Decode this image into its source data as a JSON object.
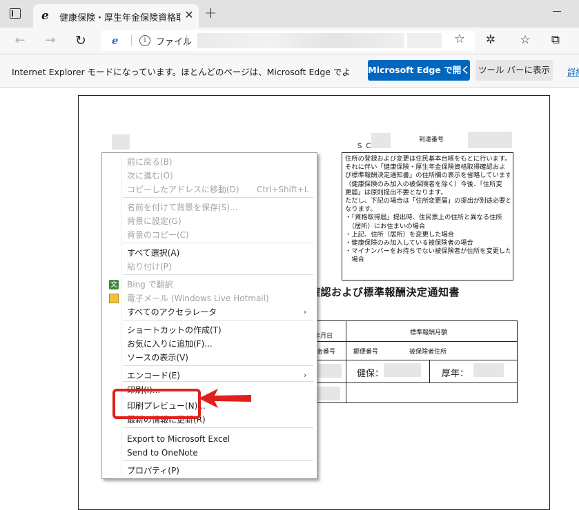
{
  "tab": {
    "title": "健康保険・厚生年金保険資格取得確認および標準報酬決定通知書",
    "favicon": "ie-logo-icon",
    "close_glyph": "✕",
    "new_tab_glyph": "+"
  },
  "address_bar": {
    "scheme_label": "ファイル"
  },
  "infobar": {
    "message": "Internet Explorer モードになっています。ほとんどのページは、Microsoft Edge でより適切に機能",
    "open_button": "Microsoft Edge で開く",
    "toolbar_button": "ツール バーに表示",
    "link": "詳細"
  },
  "document": {
    "sc_label": "ＳＣ",
    "arrival_label": "到達番号",
    "notice_lines": [
      "住所の登録および変更は住民基本台帳をもとに行います。",
      "それに伴い「健康保険・厚生年金保険資格取得確認およ",
      "び標準報酬決定通知書」の住所欄の表示を省略しています。",
      "（健康保険のみ加入の被保険者を除く）今後、「住所変",
      "更届」は原則提出不要となります。",
      "ただし、下記の場合は「住所変更届」の提出が別途必要と",
      "なります。",
      "・「資格取得届」提出時、住民票上の住所と異なる住所",
      "　（居所）にお住まいの場合",
      "・上記、住所（居所）を変更した場合",
      "・健康保険のみ加入している被保険者の場合",
      "・マイナンバーをお持ちでない被保険者が住所を変更した",
      "　場合"
    ],
    "title_visible": "確認および標準報酬決定通知書",
    "table": {
      "date_header": "年月日",
      "monthly_header": "標準報酬月額",
      "pension_no": "金番号",
      "postal_code": "郵便番号",
      "insured_address": "被保険者住所",
      "health_label": "健保：",
      "pension_label": "厚年："
    }
  },
  "context_menu": {
    "items": [
      {
        "label": "前に戻る(B)",
        "shortcut": "",
        "enabled": false,
        "submenu": false
      },
      {
        "label": "次に進む(O)",
        "shortcut": "",
        "enabled": false,
        "submenu": false
      },
      {
        "label": "コピーしたアドレスに移動(D)",
        "shortcut": "Ctrl+Shift+L",
        "enabled": false,
        "submenu": false
      },
      {
        "label": "名前を付けて背景を保存(S)...",
        "shortcut": "",
        "enabled": false,
        "submenu": false
      },
      {
        "label": "背景に設定(G)",
        "shortcut": "",
        "enabled": false,
        "submenu": false
      },
      {
        "label": "背景のコピー(C)",
        "shortcut": "",
        "enabled": false,
        "submenu": false
      },
      {
        "label": "すべて選択(A)",
        "shortcut": "",
        "enabled": true,
        "submenu": false
      },
      {
        "label": "貼り付け(P)",
        "shortcut": "",
        "enabled": false,
        "submenu": false
      },
      {
        "label": "Bing で翻訳",
        "shortcut": "",
        "enabled": false,
        "submenu": false,
        "icon": "translate-icon"
      },
      {
        "label": "電子メール (Windows Live Hotmail)",
        "shortcut": "",
        "enabled": false,
        "submenu": false,
        "icon": "mail-icon"
      },
      {
        "label": "すべてのアクセラレータ",
        "shortcut": "",
        "enabled": true,
        "submenu": true
      },
      {
        "label": "ショートカットの作成(T)",
        "shortcut": "",
        "enabled": true,
        "submenu": false
      },
      {
        "label": "お気に入りに追加(F)...",
        "shortcut": "",
        "enabled": true,
        "submenu": false
      },
      {
        "label": "ソースの表示(V)",
        "shortcut": "",
        "enabled": true,
        "submenu": false
      },
      {
        "label": "エンコード(E)",
        "shortcut": "",
        "enabled": true,
        "submenu": true
      },
      {
        "label": "印刷(I)...",
        "shortcut": "",
        "enabled": true,
        "submenu": false
      },
      {
        "label": "印刷プレビュー(N)...",
        "shortcut": "",
        "enabled": true,
        "submenu": false
      },
      {
        "label": "最新の情報に更新(R)",
        "shortcut": "",
        "enabled": true,
        "submenu": false
      },
      {
        "label": "Export to Microsoft Excel",
        "shortcut": "",
        "enabled": true,
        "submenu": false
      },
      {
        "label": "Send to OneNote",
        "shortcut": "",
        "enabled": true,
        "submenu": false
      },
      {
        "label": "プロパティ(P)",
        "shortcut": "",
        "enabled": true,
        "submenu": false
      }
    ],
    "highlighted_item": "印刷プレビュー(N)...",
    "highlight_color": "#e0211b"
  },
  "colors": {
    "accent_button": "#0067c0",
    "highlight": "#e0211b",
    "disabled_text": "#a3a3a3"
  }
}
